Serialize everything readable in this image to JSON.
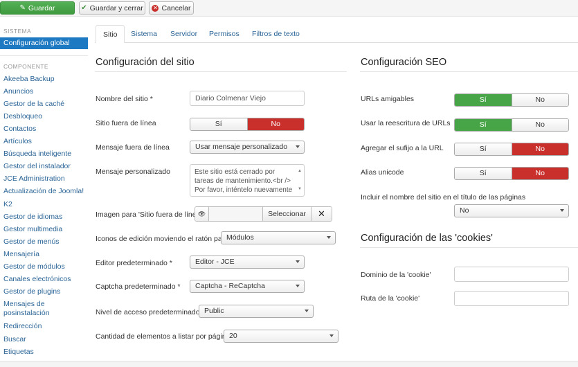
{
  "toolbar": {
    "save": "Guardar",
    "save_close": "Guardar y cerrar",
    "cancel": "Cancelar"
  },
  "sidebar": {
    "section_system": "SISTEMA",
    "global_config": "Configuración global",
    "section_component": "COMPONENTE",
    "items": [
      "Akeeba Backup",
      "Anuncios",
      "Gestor de la caché",
      "Desbloqueo",
      "Contactos",
      "Artículos",
      "Búsqueda inteligente",
      "Gestor del instalador",
      "JCE Administration",
      "Actualización de Joomla!",
      "K2",
      "Gestor de idiomas",
      "Gestor multimedia",
      "Gestor de menús",
      "Mensajería",
      "Gestor de módulos",
      "Canales electrónicos",
      "Gestor de plugins",
      "Mensajes de posinstalación",
      "Redirección",
      "Buscar",
      "Etiquetas"
    ]
  },
  "tabs": [
    "Sitio",
    "Sistema",
    "Servidor",
    "Permisos",
    "Filtros de texto"
  ],
  "site": {
    "heading": "Configuración del sitio",
    "site_name_label": "Nombre del sitio *",
    "site_name_value": "Diario Colmenar Viejo",
    "offline_label": "Sitio fuera de línea",
    "yes": "Sí",
    "no": "No",
    "offline_msg_label": "Mensaje fuera de línea",
    "offline_msg_value": "Usar mensaje personalizado",
    "custom_msg_label": "Mensaje personalizado",
    "custom_msg_line1": "Este sitio está cerrado por",
    "custom_msg_line2": "tareas de mantenimiento.<br />",
    "custom_msg_line3": "Por favor, inténtelo nuevamente",
    "offline_image_label": "Imagen para 'Sitio fuera de línea'",
    "select_btn": "Seleccionar",
    "edit_icons_label": "Iconos de edición moviendo el ratón para",
    "edit_icons_value": "Módulos",
    "editor_label": "Editor predeterminado *",
    "editor_value": "Editor - JCE",
    "captcha_label": "Captcha predeterminado *",
    "captcha_value": "Captcha - ReCaptcha",
    "access_label": "Nivel de acceso predeterminado *",
    "access_value": "Public",
    "list_limit_label": "Cantidad de elementos a listar por página",
    "list_limit_value": "20"
  },
  "seo": {
    "heading": "Configuración SEO",
    "sef_label": "URLs amigables",
    "rewrite_label": "Usar la reescritura de URLs",
    "suffix_label": "Agregar el sufijo a la URL",
    "unicode_label": "Alias unicode",
    "sitename_title_label": "Incluir el nombre del sitio en el título de las páginas",
    "sitename_title_value": "No"
  },
  "cookies": {
    "heading": "Configuración de las 'cookies'",
    "domain_label": "Dominio de la 'cookie'",
    "path_label": "Ruta de la 'cookie'"
  }
}
